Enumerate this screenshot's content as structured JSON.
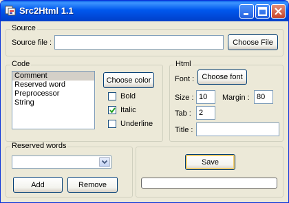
{
  "window": {
    "title": "Src2Html 1.1"
  },
  "source": {
    "group_label": "Source",
    "file_label": "Source file :",
    "file_value": "",
    "choose_file_label": "Choose File"
  },
  "code": {
    "group_label": "Code",
    "items": [
      "Comment",
      "Reserved word",
      "Preprocessor",
      "String"
    ],
    "selected": "Comment",
    "choose_color_label": "Choose color",
    "bold_label": "Bold",
    "bold_checked": false,
    "italic_label": "Italic",
    "italic_checked": true,
    "underline_label": "Underline",
    "underline_checked": false
  },
  "html": {
    "group_label": "Html",
    "font_label": "Font :",
    "choose_font_label": "Choose font",
    "size_label": "Size :",
    "size_value": "10",
    "margin_label": "Margin :",
    "margin_value": "80",
    "tab_label": "Tab :",
    "tab_value": "2",
    "title_label": "Title :",
    "title_value": ""
  },
  "reserved": {
    "group_label": "Reserved words",
    "combo_value": "",
    "add_label": "Add",
    "remove_label": "Remove"
  },
  "actions": {
    "save_label": "Save",
    "progress": 0
  }
}
